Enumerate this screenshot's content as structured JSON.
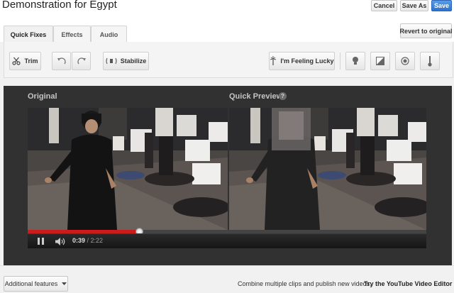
{
  "header": {
    "title": "Demonstration for Egypt",
    "cancel_label": "Cancel",
    "save_as_label": "Save As",
    "save_label": "Save"
  },
  "tabs": [
    {
      "label": "Quick Fixes",
      "active": true
    },
    {
      "label": "Effects",
      "active": false
    },
    {
      "label": "Audio",
      "active": false
    }
  ],
  "revert_label": "Revert to original",
  "toolbar": {
    "trim_label": "Trim",
    "stabilize_label": "Stabilize",
    "lucky_label": "I'm Feeling Lucky",
    "icons": [
      "scissors-icon",
      "rotate-left-icon",
      "rotate-right-icon",
      "stabilize-icon",
      "lucky-icon",
      "brightness-icon",
      "contrast-icon",
      "saturation-icon",
      "temperature-icon"
    ]
  },
  "preview": {
    "original_label": "Original",
    "quick_preview_label": "Quick Preview",
    "help_symbol": "?"
  },
  "player": {
    "current_time": "0:39",
    "duration": "/ 2:22",
    "progress": 0.28
  },
  "footer": {
    "additional_features_label": "Additional features",
    "promo_text": "Combine multiple clips and publish new videos.",
    "editor_link_label": "Try the YouTube Video Editor"
  },
  "colors": {
    "accent_blue": "#2c73cf",
    "progress_red": "#cc1b1b",
    "workspace_bg": "#313131"
  }
}
